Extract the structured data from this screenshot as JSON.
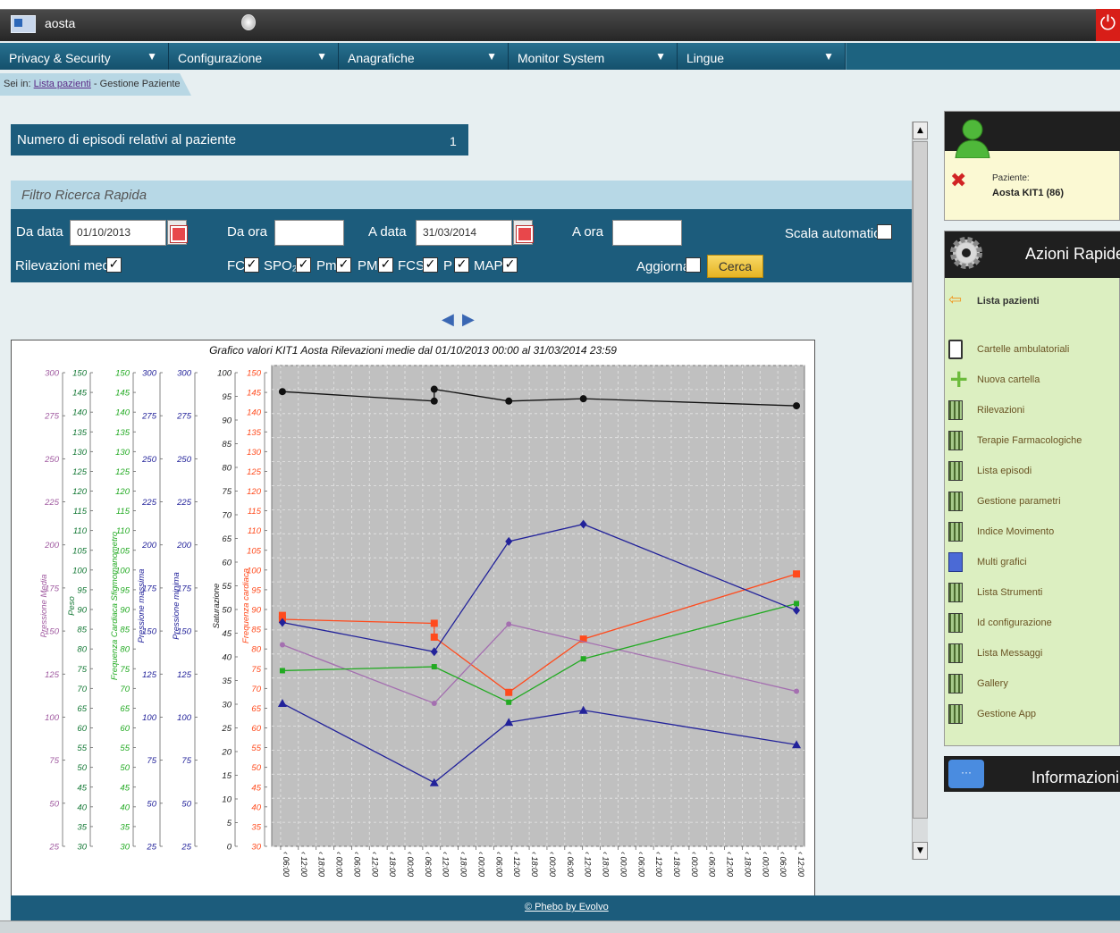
{
  "window": {
    "title": "aosta"
  },
  "menu": [
    {
      "label": "Privacy & Security"
    },
    {
      "label": "Configurazione"
    },
    {
      "label": "Anagrafiche"
    },
    {
      "label": "Monitor System"
    },
    {
      "label": "Lingue"
    }
  ],
  "breadcrumb": {
    "prefix": "Sei in:",
    "link": "Lista pazienti",
    "current": "- Gestione Paziente"
  },
  "episodes": {
    "label": "Numero di episodi relativi al paziente",
    "count": "1"
  },
  "filter": {
    "title": "Filtro Ricerca Rapida",
    "da_data_label": "Da data",
    "da_data_value": "01/10/2013",
    "da_ora_label": "Da ora",
    "da_ora_value": "",
    "a_data_label": "A data",
    "a_data_value": "31/03/2014",
    "a_ora_label": "A ora",
    "a_ora_value": "",
    "scala_label": "Scala automatica",
    "scala_checked": false,
    "rilevazioni_label": "Rilevazioni medie",
    "rilevazioni_checked": true,
    "params": [
      {
        "label": "FC",
        "checked": true
      },
      {
        "label": "SPO₂",
        "checked": true
      },
      {
        "label": "Pm",
        "checked": true
      },
      {
        "label": "PM",
        "checked": true
      },
      {
        "label": "FCS",
        "checked": true
      },
      {
        "label": "P",
        "checked": true
      },
      {
        "label": "MAP",
        "checked": true
      }
    ],
    "aggiorna_label": "Aggiorna",
    "aggiorna_checked": false,
    "cerca_label": "Cerca"
  },
  "chart_data": {
    "type": "line",
    "title": "Grafico valori KIT1 Aosta Rilevazioni medie dal 01/10/2013 00:00 al 31/03/2014 23:59",
    "plot_background": "#c0c0c0",
    "grid": true,
    "x_tick_labels": [
      "06:00",
      "12:00",
      "18:00",
      "00:00",
      "06:00",
      "12:00",
      "18:00",
      "00:00",
      "06:00",
      "12:00",
      "18:00",
      "00:00",
      "06:00",
      "12:00",
      "18:00",
      "00:00",
      "06:00",
      "12:00",
      "18:00",
      "00:00",
      "06:00",
      "12:00",
      "18:00",
      "00:00",
      "06:00",
      "12:00",
      "18:00",
      "00:00",
      "06:00",
      "12:00"
    ],
    "axes": [
      {
        "name": "Pressione Media",
        "color": "#a05aa0",
        "min": 25,
        "max": 300,
        "ticks": [
          "300",
          "275",
          "250",
          "225",
          "200",
          "175",
          "150",
          "125",
          "100",
          "75",
          "50",
          "25"
        ]
      },
      {
        "name": "Peso",
        "color": "#117733",
        "min": 30,
        "max": 150,
        "ticks": [
          "150",
          "145",
          "140",
          "135",
          "130",
          "125",
          "120",
          "115",
          "110",
          "105",
          "100",
          "95",
          "90",
          "85",
          "80",
          "75",
          "70",
          "65",
          "60",
          "55",
          "50",
          "45",
          "40",
          "35",
          "30"
        ]
      },
      {
        "name": "Frequenza Cardiaca Sfigmomanometro",
        "color": "#22aa22",
        "min": 30,
        "max": 150,
        "ticks": [
          "150",
          "145",
          "140",
          "135",
          "130",
          "125",
          "120",
          "115",
          "110",
          "105",
          "100",
          "95",
          "90",
          "85",
          "80",
          "75",
          "70",
          "65",
          "60",
          "55",
          "50",
          "45",
          "40",
          "35",
          "30"
        ]
      },
      {
        "name": "Pressione massima",
        "color": "#22229a",
        "min": 25,
        "max": 300,
        "ticks": [
          "300",
          "275",
          "250",
          "225",
          "200",
          "175",
          "150",
          "125",
          "100",
          "75",
          "50",
          "25"
        ]
      },
      {
        "name": "Pressione minima",
        "color": "#22229a",
        "min": 25,
        "max": 300,
        "ticks": [
          "300",
          "275",
          "250",
          "225",
          "200",
          "175",
          "150",
          "125",
          "100",
          "75",
          "50",
          "25"
        ]
      },
      {
        "name": "Saturazione",
        "color": "#222222",
        "min": 0,
        "max": 100,
        "ticks": [
          "100",
          "95",
          "90",
          "85",
          "80",
          "75",
          "70",
          "65",
          "60",
          "55",
          "50",
          "45",
          "40",
          "35",
          "30",
          "25",
          "20",
          "15",
          "10",
          "5",
          "0"
        ]
      },
      {
        "name": "Frequenza cardiaca",
        "color": "#ff4a1c",
        "min": 30,
        "max": 150,
        "ticks": [
          "150",
          "145",
          "140",
          "135",
          "130",
          "125",
          "120",
          "115",
          "110",
          "105",
          "100",
          "95",
          "90",
          "85",
          "80",
          "75",
          "70",
          "65",
          "60",
          "55",
          "50",
          "45",
          "40",
          "35",
          "30"
        ]
      }
    ],
    "series": [
      {
        "color": "#111111",
        "marker": "circle",
        "axis": 5,
        "points": [
          [
            0.02,
            96
          ],
          [
            0.305,
            94
          ],
          [
            0.305,
            96.5
          ],
          [
            0.445,
            94
          ],
          [
            0.585,
            94.5
          ],
          [
            0.985,
            93
          ]
        ]
      },
      {
        "color": "#ff4a1c",
        "marker": "square",
        "axis": 6,
        "points": [
          [
            0.02,
            88.5
          ],
          [
            0.02,
            87.5
          ],
          [
            0.305,
            86.5
          ],
          [
            0.305,
            83
          ],
          [
            0.445,
            69
          ],
          [
            0.585,
            82.5
          ],
          [
            0.985,
            99
          ]
        ]
      },
      {
        "color": "#a46fb0",
        "marker": "circle-small",
        "axis": 0,
        "points": [
          [
            0.02,
            142
          ],
          [
            0.305,
            108
          ],
          [
            0.445,
            154
          ],
          [
            0.985,
            115
          ]
        ]
      },
      {
        "color": "#22aa22",
        "marker": "square-small",
        "axis": 2,
        "points": [
          [
            0.02,
            74.5
          ],
          [
            0.305,
            75.5
          ],
          [
            0.445,
            66.5
          ],
          [
            0.585,
            77.5
          ],
          [
            0.985,
            91.5
          ]
        ]
      },
      {
        "color": "#22229a",
        "marker": "diamond",
        "axis": 3,
        "points": [
          [
            0.02,
            155
          ],
          [
            0.305,
            138
          ],
          [
            0.445,
            202
          ],
          [
            0.585,
            212
          ],
          [
            0.985,
            162
          ]
        ]
      },
      {
        "color": "#22229a",
        "marker": "triangle",
        "axis": 4,
        "points": [
          [
            0.02,
            108
          ],
          [
            0.305,
            62
          ],
          [
            0.445,
            97
          ],
          [
            0.585,
            104
          ],
          [
            0.985,
            84
          ]
        ]
      }
    ]
  },
  "patient": {
    "label": "Paziente:",
    "name": "Aosta KIT1 (86)"
  },
  "actions": {
    "title": "Azioni Rapide",
    "items": [
      {
        "label": "Lista pazienti",
        "icon": "arrow-left-icon"
      },
      {
        "label": "Cartelle ambulatoriali",
        "icon": "clipboard-icon"
      },
      {
        "label": "Nuova cartella",
        "icon": "plus-icon"
      },
      {
        "label": "Rilevazioni",
        "icon": "grid-icon"
      },
      {
        "label": "Terapie Farmacologiche",
        "icon": "grid-icon"
      },
      {
        "label": "Lista episodi",
        "icon": "grid-icon"
      },
      {
        "label": "Gestione parametri",
        "icon": "grid-icon"
      },
      {
        "label": "Indice Movimento",
        "icon": "grid-icon"
      },
      {
        "label": "Multi grafici",
        "icon": "chart-icon"
      },
      {
        "label": "Lista Strumenti",
        "icon": "grid-icon"
      },
      {
        "label": "Id configurazione",
        "icon": "grid-icon"
      },
      {
        "label": "Lista Messaggi",
        "icon": "grid-icon"
      },
      {
        "label": "Gallery",
        "icon": "grid-icon"
      },
      {
        "label": "Gestione App",
        "icon": "grid-icon"
      }
    ]
  },
  "info": {
    "title": "Informazioni",
    "icon_text": "···"
  },
  "footer": {
    "link": "© Phebo by Evolvo"
  }
}
